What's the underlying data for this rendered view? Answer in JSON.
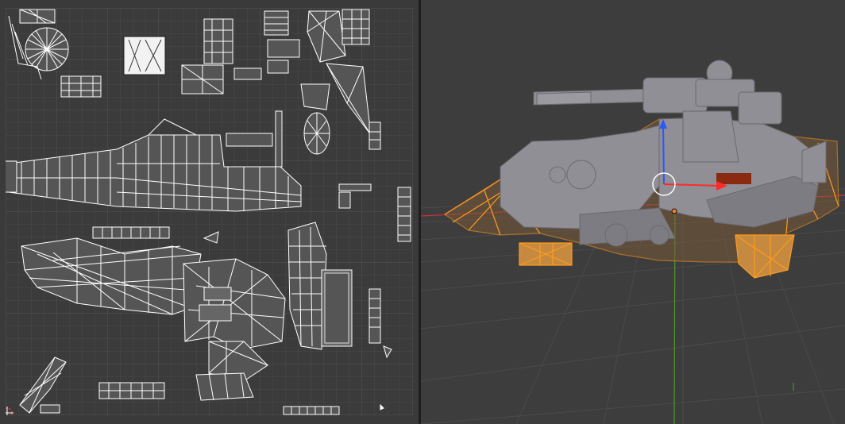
{
  "uv_editor": {
    "grid_color": "#4a4a4a",
    "grid_major_color": "#555555",
    "background": "#3b3b3b",
    "island_stroke": "#ffffff",
    "island_fill": "#5c5c5c"
  },
  "viewport": {
    "background": "#3d3d3d",
    "selection_color": "#ff9a1f",
    "mesh_color": "#8f8f95",
    "axis_x_color": "#c8323c",
    "axis_y_color": "#4f9a2e",
    "gizmo_z_color": "#2b57ff",
    "gizmo_x_color": "#ff2b2b",
    "floor_grid_color": "#4a4a4a"
  }
}
